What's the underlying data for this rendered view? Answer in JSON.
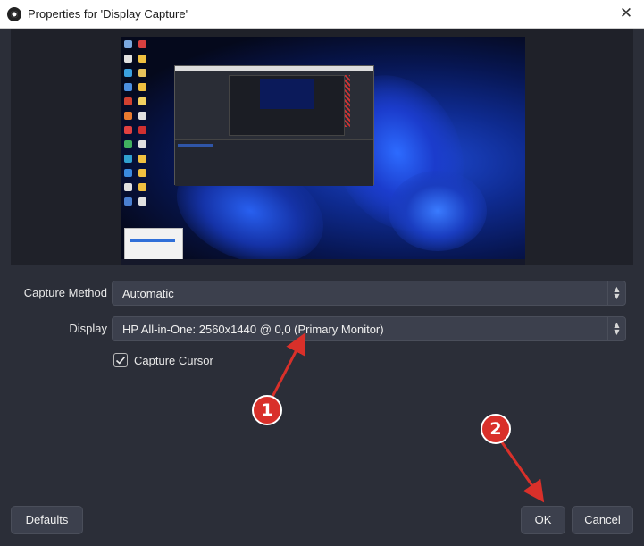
{
  "window": {
    "title": "Properties for 'Display Capture'",
    "close_glyph": "✕"
  },
  "form": {
    "capture_method": {
      "label": "Capture Method",
      "value": "Automatic"
    },
    "display": {
      "label": "Display",
      "value": "HP All-in-One: 2560x1440 @ 0,0 (Primary Monitor)"
    },
    "capture_cursor": {
      "label": "Capture Cursor",
      "checked": true
    }
  },
  "buttons": {
    "defaults": "Defaults",
    "ok": "OK",
    "cancel": "Cancel"
  },
  "annotations": {
    "marker_1": "1",
    "marker_2": "2",
    "color": "#d9302a"
  },
  "icons": [
    "obs-logo-icon",
    "close-icon",
    "spinner-arrows-icon",
    "checkmark-icon"
  ]
}
